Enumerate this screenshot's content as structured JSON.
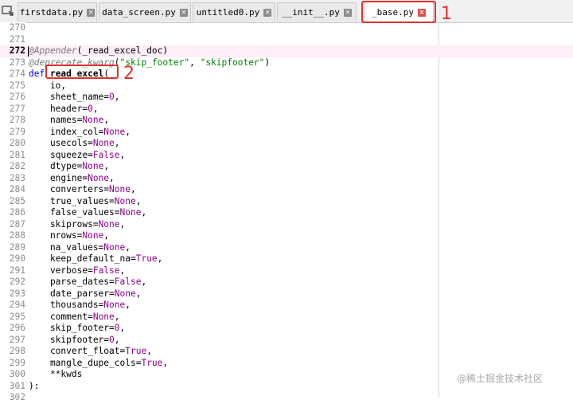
{
  "tabs": [
    {
      "label": "firstdata.py",
      "active": false
    },
    {
      "label": "data_screen.py",
      "active": false
    },
    {
      "label": "untitled0.py",
      "active": false
    },
    {
      "label": "__init__.py",
      "active": false
    },
    {
      "label": "_base.py",
      "active": true
    }
  ],
  "annotations": {
    "tab_number": "1",
    "function_number": "2"
  },
  "editor": {
    "current_line": "272",
    "lines": [
      {
        "n": "270",
        "parts": []
      },
      {
        "n": "271",
        "parts": []
      },
      {
        "n": "272",
        "parts": [
          {
            "t": "@Appender",
            "c": "dec"
          },
          {
            "t": "(_read_excel_doc)",
            "c": ""
          }
        ]
      },
      {
        "n": "273",
        "parts": [
          {
            "t": "@deprecate_kwarg",
            "c": "dec"
          },
          {
            "t": "(",
            "c": ""
          },
          {
            "t": "\"skip_footer\"",
            "c": "str"
          },
          {
            "t": ", ",
            "c": ""
          },
          {
            "t": "\"skipfooter\"",
            "c": "str"
          },
          {
            "t": ")",
            "c": ""
          }
        ]
      },
      {
        "n": "274",
        "parts": [
          {
            "t": "def ",
            "c": "kw"
          },
          {
            "t": "read_excel",
            "c": "fn"
          },
          {
            "t": "(",
            "c": ""
          }
        ]
      },
      {
        "n": "275",
        "parts": [
          {
            "t": "    io,",
            "c": ""
          }
        ]
      },
      {
        "n": "276",
        "parts": [
          {
            "t": "    sheet_name=",
            "c": ""
          },
          {
            "t": "0",
            "c": "val"
          },
          {
            "t": ",",
            "c": ""
          }
        ]
      },
      {
        "n": "277",
        "parts": [
          {
            "t": "    header=",
            "c": ""
          },
          {
            "t": "0",
            "c": "val"
          },
          {
            "t": ",",
            "c": ""
          }
        ]
      },
      {
        "n": "278",
        "parts": [
          {
            "t": "    names=",
            "c": ""
          },
          {
            "t": "None",
            "c": "val"
          },
          {
            "t": ",",
            "c": ""
          }
        ]
      },
      {
        "n": "279",
        "parts": [
          {
            "t": "    index_col=",
            "c": ""
          },
          {
            "t": "None",
            "c": "val"
          },
          {
            "t": ",",
            "c": ""
          }
        ]
      },
      {
        "n": "280",
        "parts": [
          {
            "t": "    usecols=",
            "c": ""
          },
          {
            "t": "None",
            "c": "val"
          },
          {
            "t": ",",
            "c": ""
          }
        ]
      },
      {
        "n": "281",
        "parts": [
          {
            "t": "    squeeze=",
            "c": ""
          },
          {
            "t": "False",
            "c": "val"
          },
          {
            "t": ",",
            "c": ""
          }
        ]
      },
      {
        "n": "282",
        "parts": [
          {
            "t": "    dtype=",
            "c": ""
          },
          {
            "t": "None",
            "c": "val"
          },
          {
            "t": ",",
            "c": ""
          }
        ]
      },
      {
        "n": "283",
        "parts": [
          {
            "t": "    engine=",
            "c": ""
          },
          {
            "t": "None",
            "c": "val"
          },
          {
            "t": ",",
            "c": ""
          }
        ]
      },
      {
        "n": "284",
        "parts": [
          {
            "t": "    converters=",
            "c": ""
          },
          {
            "t": "None",
            "c": "val"
          },
          {
            "t": ",",
            "c": ""
          }
        ]
      },
      {
        "n": "285",
        "parts": [
          {
            "t": "    true_values=",
            "c": ""
          },
          {
            "t": "None",
            "c": "val"
          },
          {
            "t": ",",
            "c": ""
          }
        ]
      },
      {
        "n": "286",
        "parts": [
          {
            "t": "    false_values=",
            "c": ""
          },
          {
            "t": "None",
            "c": "val"
          },
          {
            "t": ",",
            "c": ""
          }
        ]
      },
      {
        "n": "287",
        "parts": [
          {
            "t": "    skiprows=",
            "c": ""
          },
          {
            "t": "None",
            "c": "val"
          },
          {
            "t": ",",
            "c": ""
          }
        ]
      },
      {
        "n": "288",
        "parts": [
          {
            "t": "    nrows=",
            "c": ""
          },
          {
            "t": "None",
            "c": "val"
          },
          {
            "t": ",",
            "c": ""
          }
        ]
      },
      {
        "n": "289",
        "parts": [
          {
            "t": "    na_values=",
            "c": ""
          },
          {
            "t": "None",
            "c": "val"
          },
          {
            "t": ",",
            "c": ""
          }
        ]
      },
      {
        "n": "290",
        "parts": [
          {
            "t": "    keep_default_na=",
            "c": ""
          },
          {
            "t": "True",
            "c": "val"
          },
          {
            "t": ",",
            "c": ""
          }
        ]
      },
      {
        "n": "291",
        "parts": [
          {
            "t": "    verbose=",
            "c": ""
          },
          {
            "t": "False",
            "c": "val"
          },
          {
            "t": ",",
            "c": ""
          }
        ]
      },
      {
        "n": "292",
        "parts": [
          {
            "t": "    parse_dates=",
            "c": ""
          },
          {
            "t": "False",
            "c": "val"
          },
          {
            "t": ",",
            "c": ""
          }
        ]
      },
      {
        "n": "293",
        "parts": [
          {
            "t": "    date_parser=",
            "c": ""
          },
          {
            "t": "None",
            "c": "val"
          },
          {
            "t": ",",
            "c": ""
          }
        ]
      },
      {
        "n": "294",
        "parts": [
          {
            "t": "    thousands=",
            "c": ""
          },
          {
            "t": "None",
            "c": "val"
          },
          {
            "t": ",",
            "c": ""
          }
        ]
      },
      {
        "n": "295",
        "parts": [
          {
            "t": "    comment=",
            "c": ""
          },
          {
            "t": "None",
            "c": "val"
          },
          {
            "t": ",",
            "c": ""
          }
        ]
      },
      {
        "n": "296",
        "parts": [
          {
            "t": "    skip_footer=",
            "c": ""
          },
          {
            "t": "0",
            "c": "val"
          },
          {
            "t": ",",
            "c": ""
          }
        ]
      },
      {
        "n": "297",
        "parts": [
          {
            "t": "    skipfooter=",
            "c": ""
          },
          {
            "t": "0",
            "c": "val"
          },
          {
            "t": ",",
            "c": ""
          }
        ]
      },
      {
        "n": "298",
        "parts": [
          {
            "t": "    convert_float=",
            "c": ""
          },
          {
            "t": "True",
            "c": "val"
          },
          {
            "t": ",",
            "c": ""
          }
        ]
      },
      {
        "n": "299",
        "parts": [
          {
            "t": "    mangle_dupe_cols=",
            "c": ""
          },
          {
            "t": "True",
            "c": "val"
          },
          {
            "t": ",",
            "c": ""
          }
        ]
      },
      {
        "n": "300",
        "parts": [
          {
            "t": "    **kwds",
            "c": ""
          }
        ]
      },
      {
        "n": "301",
        "parts": [
          {
            "t": "):",
            "c": ""
          }
        ]
      },
      {
        "n": "302",
        "parts": []
      }
    ]
  },
  "watermark": "@稀土掘金技术社区",
  "colors": {
    "annotation": "#e3302f",
    "keyword": "#0000ff",
    "value": "#8b008b",
    "string": "#008000",
    "current_line": "#fdeef7"
  }
}
